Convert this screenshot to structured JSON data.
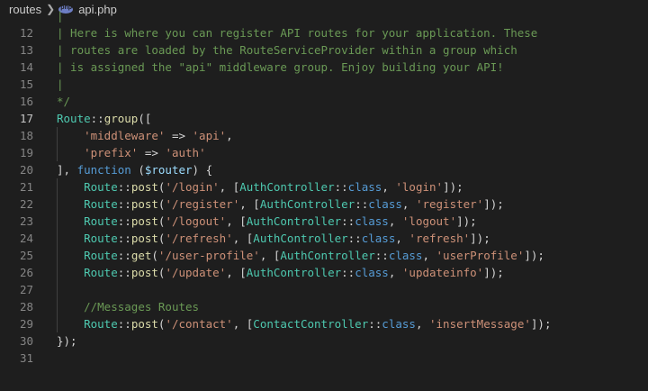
{
  "breadcrumb": {
    "folder": "routes",
    "file": "api.php",
    "file_icon": "php-file-icon"
  },
  "colors": {
    "background": "#1e1e1e",
    "line_number": "#858585",
    "comment": "#6a9955",
    "class": "#4ec9b0",
    "function": "#dcdcaa",
    "string": "#ce9178",
    "keyword": "#569cd6",
    "variable": "#9cdcfe",
    "punctuation": "#d4d4d4"
  },
  "editor": {
    "active_line": 17,
    "lines": [
      {
        "n": "",
        "tokens": [
          {
            "t": "comment",
            "v": "|"
          }
        ]
      },
      {
        "n": "12",
        "tokens": [
          {
            "t": "comment",
            "v": "| Here is where you can register API routes for your application. These"
          }
        ]
      },
      {
        "n": "13",
        "tokens": [
          {
            "t": "comment",
            "v": "| routes are loaded by the RouteServiceProvider within a group which"
          }
        ]
      },
      {
        "n": "14",
        "tokens": [
          {
            "t": "comment",
            "v": "| is assigned the \"api\" middleware group. Enjoy building your API!"
          }
        ]
      },
      {
        "n": "15",
        "tokens": [
          {
            "t": "comment",
            "v": "|"
          }
        ]
      },
      {
        "n": "16",
        "tokens": [
          {
            "t": "comment",
            "v": "*/"
          }
        ]
      },
      {
        "n": "17",
        "tokens": [
          {
            "t": "class",
            "v": "Route"
          },
          {
            "t": "punct",
            "v": "::"
          },
          {
            "t": "func",
            "v": "group"
          },
          {
            "t": "punct",
            "v": "(["
          }
        ]
      },
      {
        "n": "18",
        "tokens": [
          {
            "t": "punct",
            "v": "    "
          },
          {
            "t": "string",
            "v": "'middleware'"
          },
          {
            "t": "punct",
            "v": " => "
          },
          {
            "t": "string",
            "v": "'api'"
          },
          {
            "t": "punct",
            "v": ","
          }
        ]
      },
      {
        "n": "19",
        "tokens": [
          {
            "t": "punct",
            "v": "    "
          },
          {
            "t": "string",
            "v": "'prefix'"
          },
          {
            "t": "punct",
            "v": " => "
          },
          {
            "t": "string",
            "v": "'auth'"
          }
        ]
      },
      {
        "n": "20",
        "tokens": [
          {
            "t": "punct",
            "v": "], "
          },
          {
            "t": "keyword",
            "v": "function"
          },
          {
            "t": "punct",
            "v": " ("
          },
          {
            "t": "var",
            "v": "$router"
          },
          {
            "t": "punct",
            "v": ") {"
          }
        ]
      },
      {
        "n": "21",
        "tokens": [
          {
            "t": "punct",
            "v": "    "
          },
          {
            "t": "class",
            "v": "Route"
          },
          {
            "t": "punct",
            "v": "::"
          },
          {
            "t": "func",
            "v": "post"
          },
          {
            "t": "punct",
            "v": "("
          },
          {
            "t": "string",
            "v": "'/login'"
          },
          {
            "t": "punct",
            "v": ", ["
          },
          {
            "t": "class",
            "v": "AuthController"
          },
          {
            "t": "punct",
            "v": "::"
          },
          {
            "t": "keyword",
            "v": "class"
          },
          {
            "t": "punct",
            "v": ", "
          },
          {
            "t": "string",
            "v": "'login'"
          },
          {
            "t": "punct",
            "v": "]);"
          }
        ]
      },
      {
        "n": "22",
        "tokens": [
          {
            "t": "punct",
            "v": "    "
          },
          {
            "t": "class",
            "v": "Route"
          },
          {
            "t": "punct",
            "v": "::"
          },
          {
            "t": "func",
            "v": "post"
          },
          {
            "t": "punct",
            "v": "("
          },
          {
            "t": "string",
            "v": "'/register'"
          },
          {
            "t": "punct",
            "v": ", ["
          },
          {
            "t": "class",
            "v": "AuthController"
          },
          {
            "t": "punct",
            "v": "::"
          },
          {
            "t": "keyword",
            "v": "class"
          },
          {
            "t": "punct",
            "v": ", "
          },
          {
            "t": "string",
            "v": "'register'"
          },
          {
            "t": "punct",
            "v": "]);"
          }
        ]
      },
      {
        "n": "23",
        "tokens": [
          {
            "t": "punct",
            "v": "    "
          },
          {
            "t": "class",
            "v": "Route"
          },
          {
            "t": "punct",
            "v": "::"
          },
          {
            "t": "func",
            "v": "post"
          },
          {
            "t": "punct",
            "v": "("
          },
          {
            "t": "string",
            "v": "'/logout'"
          },
          {
            "t": "punct",
            "v": ", ["
          },
          {
            "t": "class",
            "v": "AuthController"
          },
          {
            "t": "punct",
            "v": "::"
          },
          {
            "t": "keyword",
            "v": "class"
          },
          {
            "t": "punct",
            "v": ", "
          },
          {
            "t": "string",
            "v": "'logout'"
          },
          {
            "t": "punct",
            "v": "]);"
          }
        ]
      },
      {
        "n": "24",
        "tokens": [
          {
            "t": "punct",
            "v": "    "
          },
          {
            "t": "class",
            "v": "Route"
          },
          {
            "t": "punct",
            "v": "::"
          },
          {
            "t": "func",
            "v": "post"
          },
          {
            "t": "punct",
            "v": "("
          },
          {
            "t": "string",
            "v": "'/refresh'"
          },
          {
            "t": "punct",
            "v": ", ["
          },
          {
            "t": "class",
            "v": "AuthController"
          },
          {
            "t": "punct",
            "v": "::"
          },
          {
            "t": "keyword",
            "v": "class"
          },
          {
            "t": "punct",
            "v": ", "
          },
          {
            "t": "string",
            "v": "'refresh'"
          },
          {
            "t": "punct",
            "v": "]);"
          }
        ]
      },
      {
        "n": "25",
        "tokens": [
          {
            "t": "punct",
            "v": "    "
          },
          {
            "t": "class",
            "v": "Route"
          },
          {
            "t": "punct",
            "v": "::"
          },
          {
            "t": "func",
            "v": "get"
          },
          {
            "t": "punct",
            "v": "("
          },
          {
            "t": "string",
            "v": "'/user-profile'"
          },
          {
            "t": "punct",
            "v": ", ["
          },
          {
            "t": "class",
            "v": "AuthController"
          },
          {
            "t": "punct",
            "v": "::"
          },
          {
            "t": "keyword",
            "v": "class"
          },
          {
            "t": "punct",
            "v": ", "
          },
          {
            "t": "string",
            "v": "'userProfile'"
          },
          {
            "t": "punct",
            "v": "]);"
          }
        ]
      },
      {
        "n": "26",
        "tokens": [
          {
            "t": "punct",
            "v": "    "
          },
          {
            "t": "class",
            "v": "Route"
          },
          {
            "t": "punct",
            "v": "::"
          },
          {
            "t": "func",
            "v": "post"
          },
          {
            "t": "punct",
            "v": "("
          },
          {
            "t": "string",
            "v": "'/update'"
          },
          {
            "t": "punct",
            "v": ", ["
          },
          {
            "t": "class",
            "v": "AuthController"
          },
          {
            "t": "punct",
            "v": "::"
          },
          {
            "t": "keyword",
            "v": "class"
          },
          {
            "t": "punct",
            "v": ", "
          },
          {
            "t": "string",
            "v": "'updateinfo'"
          },
          {
            "t": "punct",
            "v": "]);"
          }
        ]
      },
      {
        "n": "27",
        "tokens": []
      },
      {
        "n": "28",
        "tokens": [
          {
            "t": "punct",
            "v": "    "
          },
          {
            "t": "comment",
            "v": "//Messages Routes"
          }
        ]
      },
      {
        "n": "29",
        "tokens": [
          {
            "t": "punct",
            "v": "    "
          },
          {
            "t": "class",
            "v": "Route"
          },
          {
            "t": "punct",
            "v": "::"
          },
          {
            "t": "func",
            "v": "post"
          },
          {
            "t": "punct",
            "v": "("
          },
          {
            "t": "string",
            "v": "'/contact'"
          },
          {
            "t": "punct",
            "v": ", ["
          },
          {
            "t": "class",
            "v": "ContactController"
          },
          {
            "t": "punct",
            "v": "::"
          },
          {
            "t": "keyword",
            "v": "class"
          },
          {
            "t": "punct",
            "v": ", "
          },
          {
            "t": "string",
            "v": "'insertMessage'"
          },
          {
            "t": "punct",
            "v": "]);"
          }
        ]
      },
      {
        "n": "30",
        "tokens": [
          {
            "t": "punct",
            "v": "});"
          }
        ]
      },
      {
        "n": "31",
        "tokens": []
      }
    ]
  }
}
